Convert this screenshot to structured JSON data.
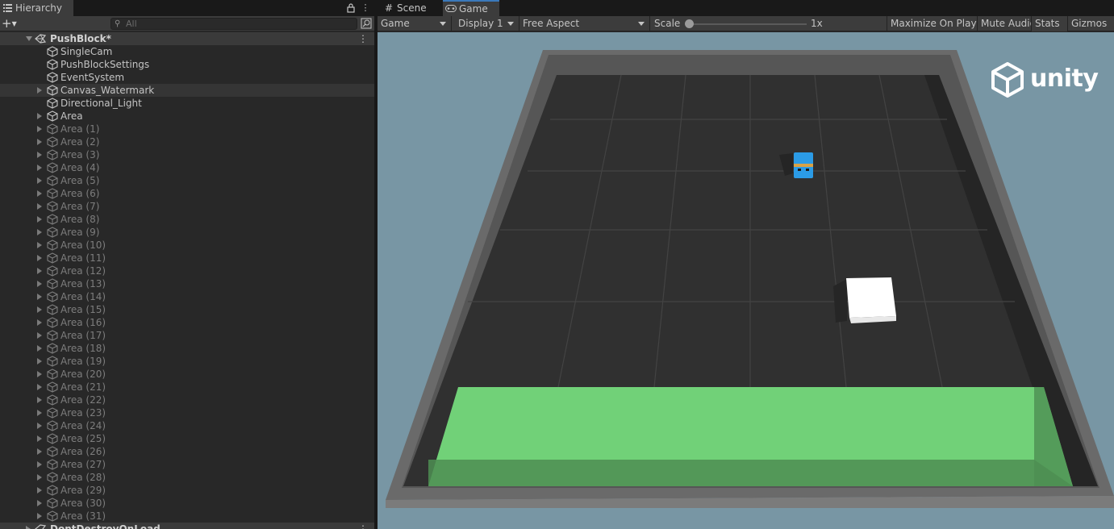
{
  "hierarchy": {
    "tab_label": "Hierarchy",
    "search_placeholder": "All",
    "scene_name": "PushBlock*",
    "next_scene_name": "DontDestroyOnLoad",
    "items": [
      {
        "label": "SingleCam",
        "expandable": false,
        "dim": false
      },
      {
        "label": "PushBlockSettings",
        "expandable": false,
        "dim": false
      },
      {
        "label": "EventSystem",
        "expandable": false,
        "dim": false
      },
      {
        "label": "Canvas_Watermark",
        "expandable": true,
        "dim": false,
        "selected": true
      },
      {
        "label": "Directional_Light",
        "expandable": false,
        "dim": false
      },
      {
        "label": "Area",
        "expandable": true,
        "dim": false
      },
      {
        "label": "Area (1)",
        "expandable": true,
        "dim": true
      },
      {
        "label": "Area (2)",
        "expandable": true,
        "dim": true
      },
      {
        "label": "Area (3)",
        "expandable": true,
        "dim": true
      },
      {
        "label": "Area (4)",
        "expandable": true,
        "dim": true
      },
      {
        "label": "Area (5)",
        "expandable": true,
        "dim": true
      },
      {
        "label": "Area (6)",
        "expandable": true,
        "dim": true
      },
      {
        "label": "Area (7)",
        "expandable": true,
        "dim": true
      },
      {
        "label": "Area (8)",
        "expandable": true,
        "dim": true
      },
      {
        "label": "Area (9)",
        "expandable": true,
        "dim": true
      },
      {
        "label": "Area (10)",
        "expandable": true,
        "dim": true
      },
      {
        "label": "Area (11)",
        "expandable": true,
        "dim": true
      },
      {
        "label": "Area (12)",
        "expandable": true,
        "dim": true
      },
      {
        "label": "Area (13)",
        "expandable": true,
        "dim": true
      },
      {
        "label": "Area (14)",
        "expandable": true,
        "dim": true
      },
      {
        "label": "Area (15)",
        "expandable": true,
        "dim": true
      },
      {
        "label": "Area (16)",
        "expandable": true,
        "dim": true
      },
      {
        "label": "Area (17)",
        "expandable": true,
        "dim": true
      },
      {
        "label": "Area (18)",
        "expandable": true,
        "dim": true
      },
      {
        "label": "Area (19)",
        "expandable": true,
        "dim": true
      },
      {
        "label": "Area (20)",
        "expandable": true,
        "dim": true
      },
      {
        "label": "Area (21)",
        "expandable": true,
        "dim": true
      },
      {
        "label": "Area (22)",
        "expandable": true,
        "dim": true
      },
      {
        "label": "Area (23)",
        "expandable": true,
        "dim": true
      },
      {
        "label": "Area (24)",
        "expandable": true,
        "dim": true
      },
      {
        "label": "Area (25)",
        "expandable": true,
        "dim": true
      },
      {
        "label": "Area (26)",
        "expandable": true,
        "dim": true
      },
      {
        "label": "Area (27)",
        "expandable": true,
        "dim": true
      },
      {
        "label": "Area (28)",
        "expandable": true,
        "dim": true
      },
      {
        "label": "Area (29)",
        "expandable": true,
        "dim": true
      },
      {
        "label": "Area (30)",
        "expandable": true,
        "dim": true
      },
      {
        "label": "Area (31)",
        "expandable": true,
        "dim": true
      }
    ]
  },
  "game": {
    "tabs": {
      "scene": "Scene",
      "game": "Game"
    },
    "toolbar": {
      "view_mode": "Game",
      "display": "Display 1",
      "aspect": "Free Aspect",
      "scale_label": "Scale",
      "scale_value": "1x",
      "maximize": "Maximize On Play",
      "mute": "Mute Audio",
      "stats": "Stats",
      "gizmos": "Gizmos"
    },
    "watermark": "unity",
    "colors": {
      "sky": "#7896a4",
      "floor": "#2f2f2f",
      "goal": "#71d178",
      "agent": "#2b9be6",
      "block": "#ffffff",
      "accent": "#3a79bb"
    }
  }
}
